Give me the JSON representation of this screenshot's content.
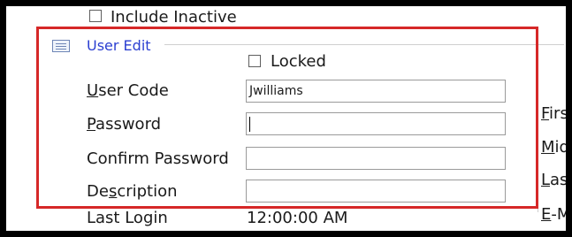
{
  "filters": {
    "include_inactive_label": "Include Inactive",
    "include_inactive_checked": false
  },
  "group": {
    "title": "User Edit",
    "icon": "form-icon"
  },
  "locked": {
    "label": "Locked",
    "checked": false
  },
  "fields": {
    "user_code": {
      "label_pre": "",
      "label_u": "U",
      "label_post": "ser Code",
      "value": "Jwilliams"
    },
    "password": {
      "label_pre": "",
      "label_u": "P",
      "label_post": "assword",
      "value": ""
    },
    "confirm_password": {
      "label": "Confirm Password",
      "value": ""
    },
    "description": {
      "label_pre": "De",
      "label_u": "s",
      "label_post": "cription",
      "value": ""
    },
    "last_login": {
      "label": "Last Login",
      "value": "12:00:00 AM"
    }
  },
  "right_labels": {
    "first": {
      "u": "F",
      "rest": "irs"
    },
    "middle": {
      "u": "M",
      "rest": "id"
    },
    "last": {
      "u": "L",
      "rest": "ast"
    },
    "email": {
      "u": "E",
      "rest": "-M"
    }
  },
  "colors": {
    "highlight": "#d62828",
    "group_title": "#2b3fd1"
  }
}
